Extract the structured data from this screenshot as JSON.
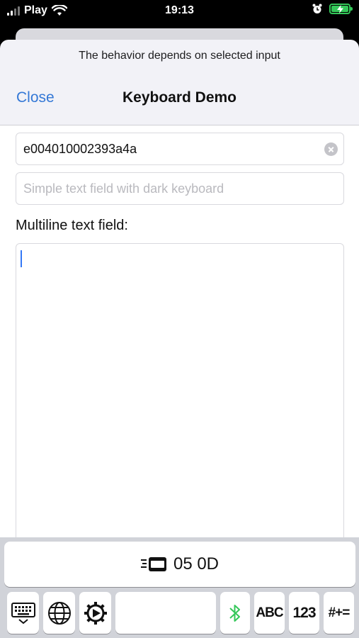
{
  "status_bar": {
    "carrier": "Play",
    "time": "19:13",
    "icons": [
      "signal-icon",
      "wifi-icon",
      "alarm-icon",
      "battery-charging-icon"
    ],
    "battery_color": "#34c759"
  },
  "sheet": {
    "subtitle": "The behavior depends on selected input",
    "close_label": "Close",
    "title": "Keyboard Demo",
    "accent_color": "#3478d6"
  },
  "form": {
    "text_field_value": "e004010002393a4a",
    "dark_field_placeholder": "Simple text field with dark keyboard",
    "multiline_label": "Multiline text field:",
    "multiline_value": ""
  },
  "keyboard": {
    "scan_result": "05 0D",
    "keys": [
      {
        "name": "hide-keyboard-icon",
        "label": ""
      },
      {
        "name": "globe-icon",
        "label": ""
      },
      {
        "name": "settings-gear-icon",
        "label": ""
      },
      {
        "name": "space-key",
        "label": ""
      },
      {
        "name": "bluetooth-icon",
        "label": ""
      },
      {
        "name": "abc-key",
        "label": "ABC"
      },
      {
        "name": "numbers-key",
        "label": "123"
      },
      {
        "name": "symbols-key",
        "label": "#+="
      }
    ],
    "bluetooth_color": "#34c759"
  }
}
